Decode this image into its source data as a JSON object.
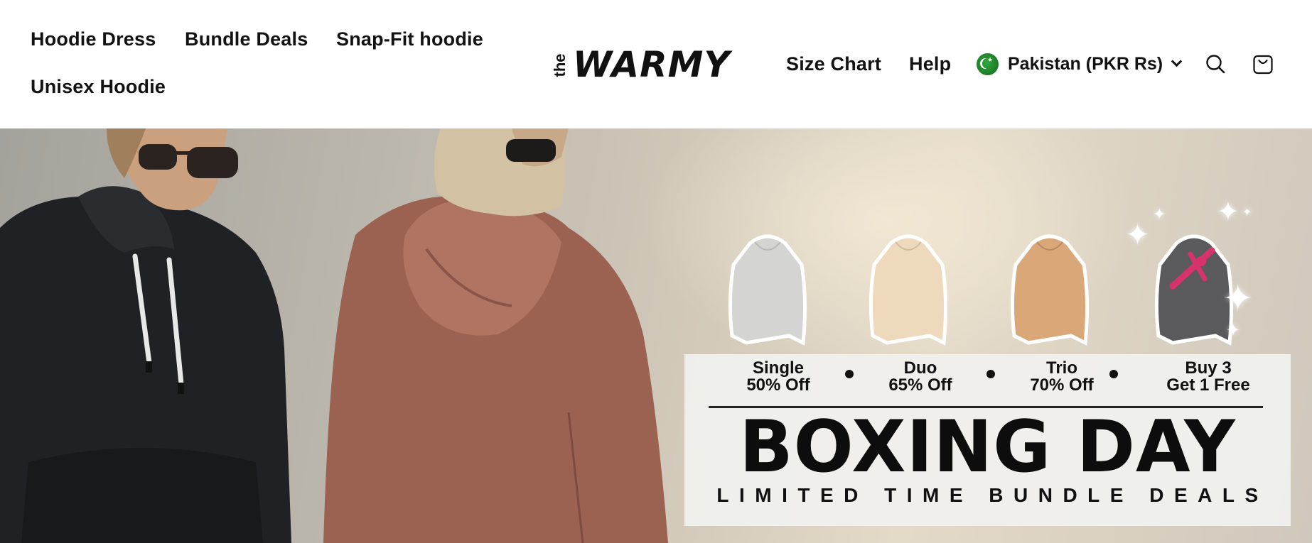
{
  "header": {
    "nav_left": [
      {
        "label": "Hoodie Dress"
      },
      {
        "label": "Bundle Deals"
      },
      {
        "label": "Snap-Fit hoodie"
      },
      {
        "label": "Unisex Hoodie"
      }
    ],
    "logo": {
      "prefix": "the",
      "main": "WARMY"
    },
    "nav_right": [
      {
        "label": "Size Chart"
      },
      {
        "label": "Help"
      }
    ],
    "country_selector": {
      "label": "Pakistan (PKR Rs)",
      "flag_icon": "pakistan-flag-icon"
    },
    "icons": {
      "search": "search-icon",
      "cart": "cart-icon"
    }
  },
  "hero": {
    "deals": [
      {
        "line1": "Single",
        "line2": "50% Off"
      },
      {
        "line1": "Duo",
        "line2": "65% Off"
      },
      {
        "line1": "Trio",
        "line2": "70% Off"
      },
      {
        "line1": "Buy 3",
        "line2": "Get 1 Free"
      }
    ],
    "headline": "BOXING DAY",
    "subheadline": "LIMITED TIME BUNDLE DEALS",
    "thumbnail_colors": [
      "#d4d4d2",
      "#efd9bc",
      "#d9a778",
      "#5a5a5c"
    ],
    "accent_ribbon_color": "#d6336c"
  }
}
